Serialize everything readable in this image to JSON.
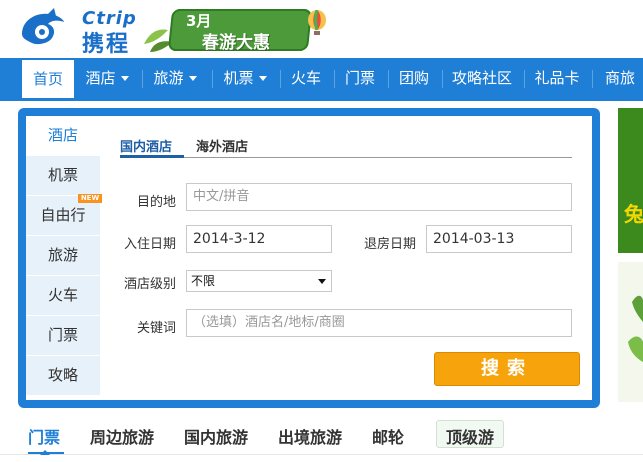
{
  "header": {
    "logo_en": "Ctrip",
    "logo_cn": "携程",
    "promo_top": "3月",
    "promo_main": "春游大惠"
  },
  "nav": {
    "items": [
      {
        "label": "首页",
        "active": true
      },
      {
        "label": "酒店",
        "dropdown": true
      },
      {
        "label": "旅游",
        "dropdown": true
      },
      {
        "label": "机票",
        "dropdown": true
      },
      {
        "label": "火车"
      },
      {
        "label": "门票"
      },
      {
        "label": "团购"
      },
      {
        "label": "攻略社区"
      },
      {
        "label": "礼品卡"
      },
      {
        "label": "商旅"
      }
    ]
  },
  "side_tabs": [
    {
      "label": "酒店",
      "active": true
    },
    {
      "label": "机票"
    },
    {
      "label": "自由行",
      "badge": "NEW"
    },
    {
      "label": "旅游"
    },
    {
      "label": "火车"
    },
    {
      "label": "门票"
    },
    {
      "label": "攻略"
    }
  ],
  "hotel_form": {
    "tabs": [
      {
        "label": "国内酒店",
        "active": true
      },
      {
        "label": "海外酒店"
      }
    ],
    "destination_label": "目的地",
    "destination_placeholder": "中文/拼音",
    "checkin_label": "入住日期",
    "checkin_value": "2014-3-12",
    "checkout_label": "退房日期",
    "checkout_value": "2014-03-13",
    "star_label": "酒店级别",
    "star_value": "不限",
    "keyword_label": "关键词",
    "keyword_placeholder": "（选填）酒店名/地标/商圈",
    "search_button": "搜索"
  },
  "bottom_tabs": [
    {
      "label": "门票",
      "active": true
    },
    {
      "label": "周边旅游"
    },
    {
      "label": "国内旅游"
    },
    {
      "label": "出境旅游"
    },
    {
      "label": "邮轮"
    },
    {
      "label": "顶级游"
    }
  ],
  "ads": {
    "ad1_text": "兔"
  },
  "colors": {
    "brand_blue": "#1f7fd6",
    "search_orange": "#f7a30b",
    "tab_bg": "#e7f1fa"
  }
}
